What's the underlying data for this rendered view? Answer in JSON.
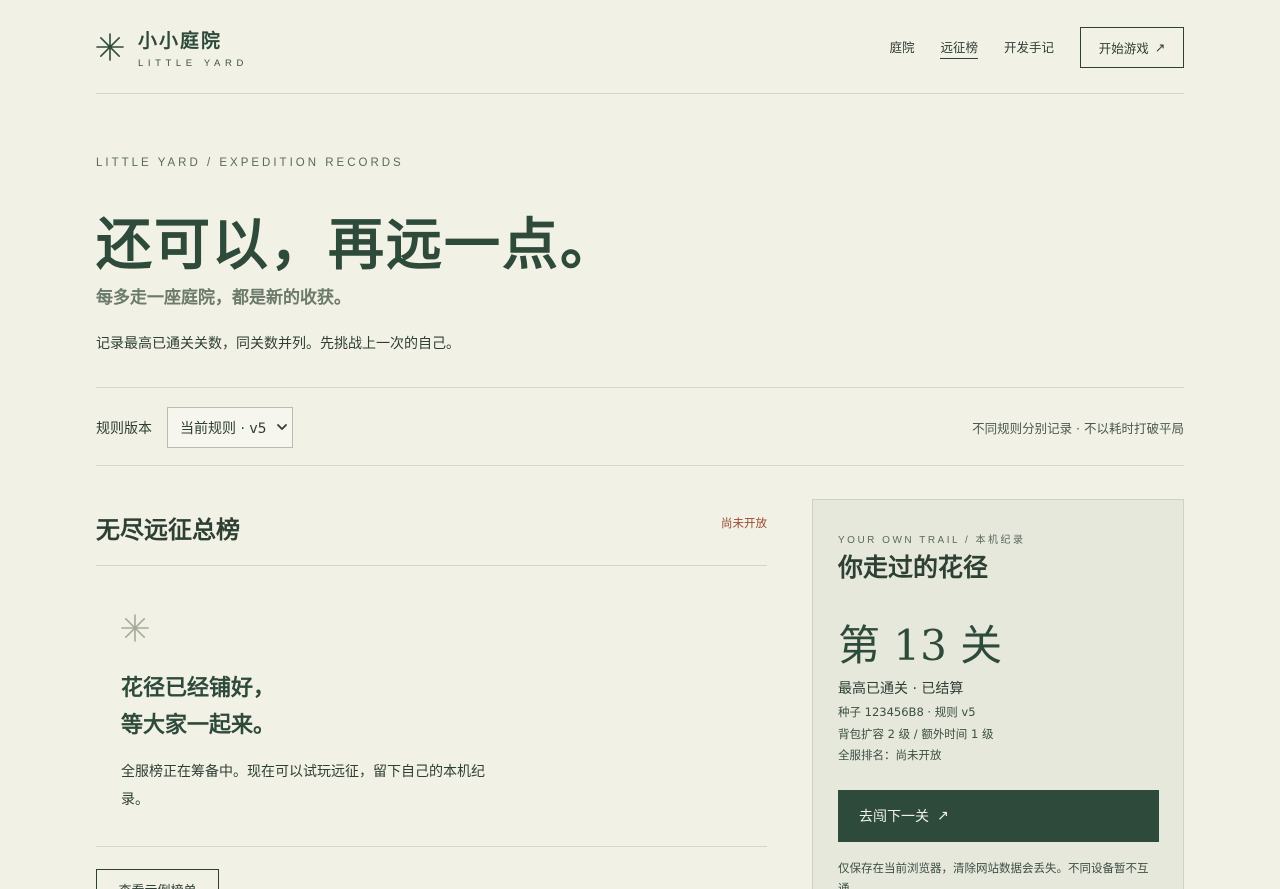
{
  "header": {
    "brand_cn": "小小庭院",
    "brand_en": "LITTLE YARD",
    "nav": [
      {
        "label": "庭院",
        "active": false
      },
      {
        "label": "远征榜",
        "active": true
      },
      {
        "label": "开发手记",
        "active": false
      }
    ],
    "cta_label": "开始游戏",
    "cta_icon": "↗"
  },
  "hero": {
    "eyebrow": "LITTLE YARD / EXPEDITION RECORDS",
    "title": "还可以，再远一点。",
    "subtitle": "每多走一座庭院，都是新的收获。",
    "description": "记录最高已通关关数，同关数并列。先挑战上一次的自己。"
  },
  "rules": {
    "label": "规则版本",
    "selected": "当前规则 · v5",
    "note": "不同规则分别记录 · 不以耗时打破平局"
  },
  "board": {
    "title": "无尽远征总榜",
    "status": "尚未开放",
    "empty_heading_1": "花径已经铺好，",
    "empty_heading_2": "等大家一起来。",
    "empty_text": "全服榜正在筹备中。现在可以试玩远征，留下自己的本机纪录。",
    "sample_button": "查看示例榜单"
  },
  "card": {
    "eyebrow": "YOUR OWN TRAIL / 本机纪录",
    "title": "你走过的花径",
    "level": "第 13 关",
    "state": "最高已通关 · 已结算",
    "seed": "种子 123456B8 · 规则 v5",
    "bag": "背包扩容 2 级 / 额外时间 1 级",
    "rank": "全服排名：尚未开放",
    "cta_label": "去闯下一关",
    "cta_icon": "↗",
    "note": "仅保存在当前浏览器，清除网站数据会丢失。不同设备暂不互通。"
  },
  "colors": {
    "background": "#f2f1e6",
    "primary": "#2e4a3a",
    "card_bg": "#e6e8dc",
    "status_accent": "#9a4a33"
  }
}
